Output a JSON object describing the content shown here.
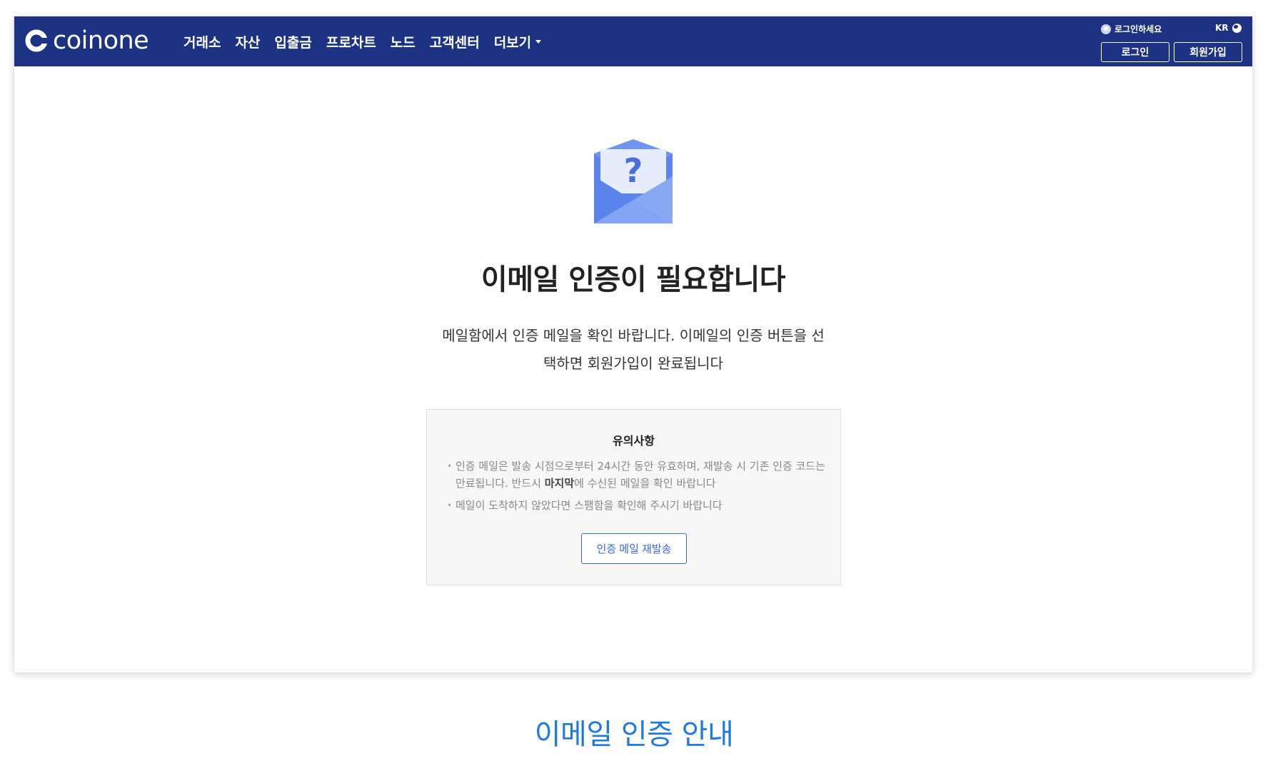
{
  "header": {
    "logo_text": "coinone",
    "nav": [
      {
        "label": "거래소"
      },
      {
        "label": "자산"
      },
      {
        "label": "입출금"
      },
      {
        "label": "프로차트"
      },
      {
        "label": "노드"
      },
      {
        "label": "고객센터"
      },
      {
        "label": "더보기"
      }
    ],
    "login_hint": "로그인하세요",
    "language": "KR",
    "login_button": "로그인",
    "signup_button": "회원가입"
  },
  "main": {
    "title": "이메일 인증이 필요합니다",
    "description_line1": "메일함에서 인증 메일을 확인 바랍니다. 이메일의 인증 버튼을 선",
    "description_line2": "택하면 회원가입이 완료됩니다",
    "notice": {
      "title": "유의사항",
      "item1_part1": "인증 메일은 발송 시점으로부터 24시간 동안 유효하며, 재발송 시 기존 인증 코드는 만료됩니다. 반드시 ",
      "item1_bold": "마지막",
      "item1_part2": "에 수신된 메일을 확인 바랍니다",
      "item2": "메일이 도착하지 않았다면 스팸함을 확인해 주시기 바랍니다",
      "resend_button": "인증 메일 재발송"
    }
  },
  "caption": "이메일 인증 안내",
  "colors": {
    "header_bg": "#1d3282",
    "accent": "#3d67d8",
    "caption": "#1f7ae0"
  },
  "icons": [
    "coinone-logo-icon",
    "user-icon",
    "globe-icon",
    "envelope-question-icon",
    "chevron-down-icon"
  ]
}
